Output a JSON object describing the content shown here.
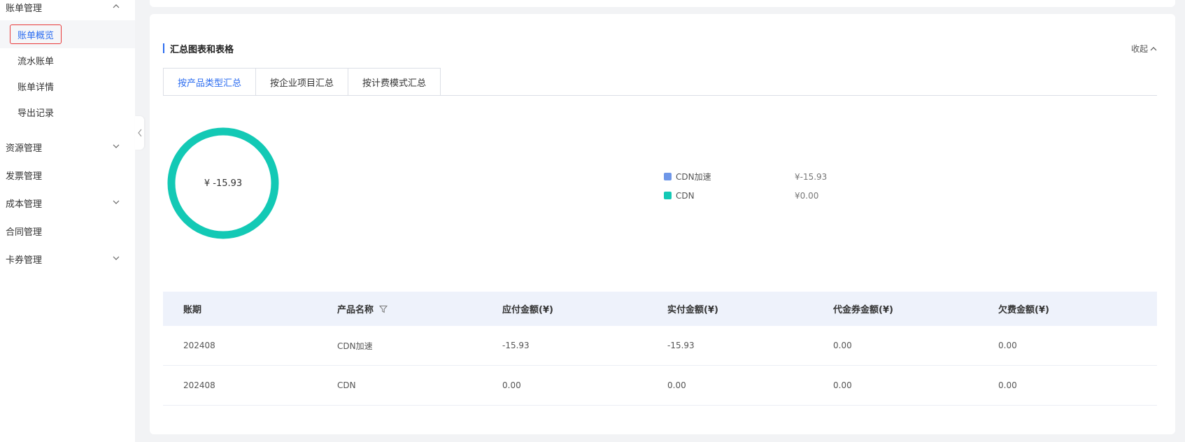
{
  "sidebar": {
    "groups": [
      {
        "label": "账单管理",
        "expanded": true
      },
      {
        "label": "资源管理",
        "expanded": false
      },
      {
        "label": "发票管理"
      },
      {
        "label": "成本管理",
        "expanded": false
      },
      {
        "label": "合同管理"
      },
      {
        "label": "卡券管理",
        "expanded": false
      }
    ],
    "bill_items": [
      "账单概览",
      "流水账单",
      "账单详情",
      "导出记录"
    ],
    "active_item": "账单概览"
  },
  "section": {
    "title": "汇总图表和表格",
    "collapse_label": "收起"
  },
  "tabs": [
    "按产品类型汇总",
    "按企业项目汇总",
    "按计费模式汇总"
  ],
  "active_tab": "按产品类型汇总",
  "chart_data": {
    "type": "pie",
    "center_label": "¥ -15.93",
    "slices": [
      {
        "name": "CDN加速",
        "value": -15.93,
        "value_label": "¥-15.93",
        "color": "#6f97e8"
      },
      {
        "name": "CDN",
        "value": 0.0,
        "value_label": "¥0.00",
        "color": "#13c9b5"
      }
    ],
    "ring_color": "#13c9b5"
  },
  "table": {
    "headers": [
      "账期",
      "产品名称",
      "应付金额(¥)",
      "实付金额(¥)",
      "代金券金额(¥)",
      "欠费金额(¥)"
    ],
    "rows": [
      [
        "202408",
        "CDN加速",
        "-15.93",
        "-15.93",
        "0.00",
        "0.00"
      ],
      [
        "202408",
        "CDN",
        "0.00",
        "0.00",
        "0.00",
        "0.00"
      ]
    ]
  },
  "colors": {
    "accent": "#2b6cf0",
    "active_outline": "#e83a3a",
    "header_bg": "#eef2fb"
  }
}
